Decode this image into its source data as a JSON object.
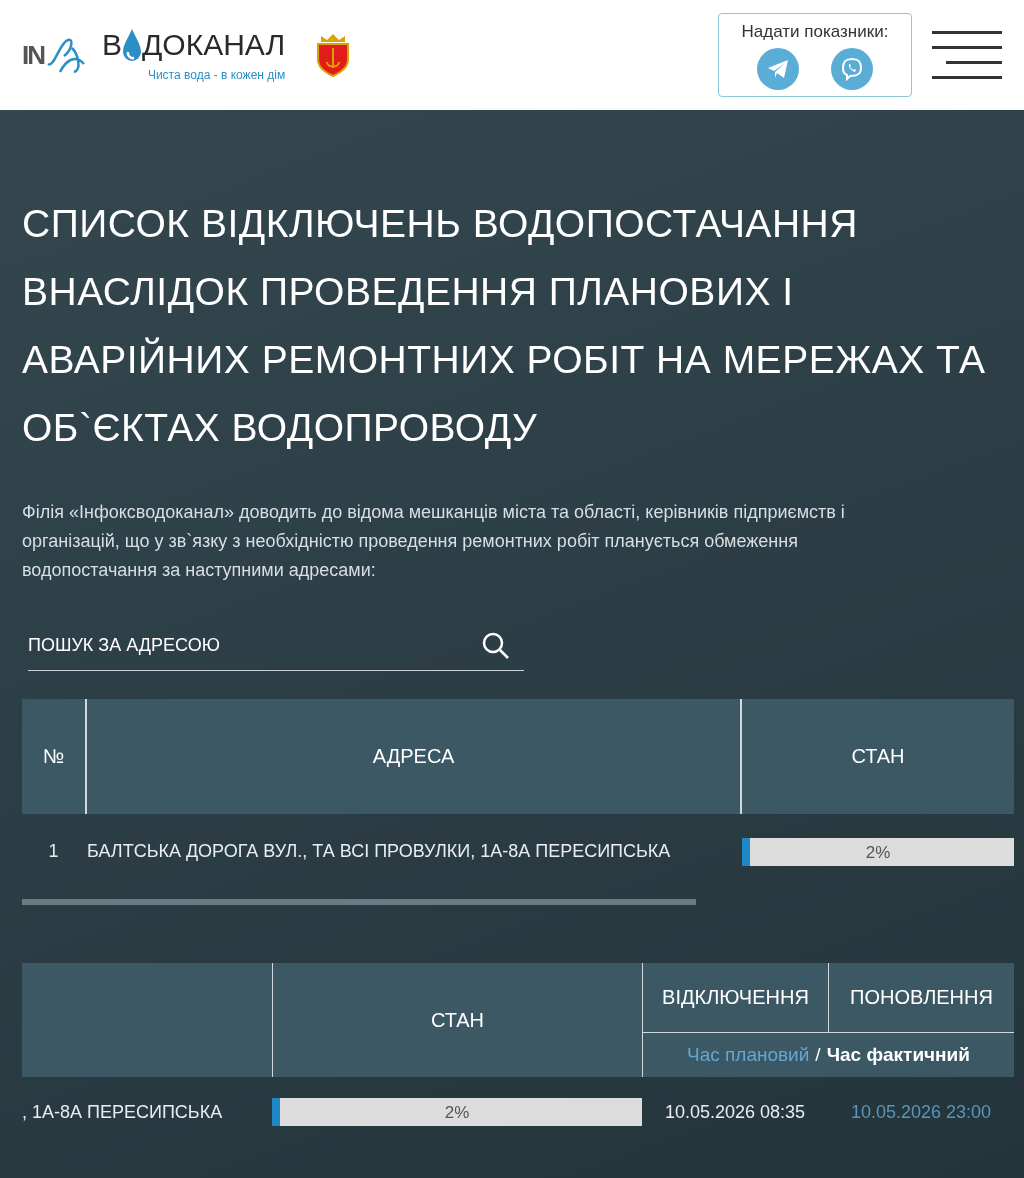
{
  "header": {
    "logo_mark": "IN",
    "brand_first": "В",
    "brand_rest": "ДОКАНАЛ",
    "tagline": "Чиста вода - в кожен дім",
    "submit_box": {
      "label": "Надати показники:"
    }
  },
  "title": "СПИСОК ВІДКЛЮЧЕНЬ ВОДОПОСТАЧАННЯ ВНАСЛІДОК ПРОВЕДЕННЯ ПЛАНОВИХ І АВАРІЙНИХ РЕМОНТНИХ РОБІТ НА МЕРЕЖАХ ТА ОБ`ЄКТАХ ВОДОПРОВОДУ",
  "intro": "Філія «Інфоксводоканал» доводить до відома мешканців міста та області, керівників підприємств і організацій, що у зв`язку з необхідністю проведення ремонтних робіт планується обмеження водопостачання за наступними адресами:",
  "search": {
    "placeholder": "ПОШУК ЗА АДРЕСОЮ"
  },
  "table": {
    "columns": [
      "№",
      "АДРЕСА",
      "СТАН"
    ],
    "rows": [
      {
        "number": "1",
        "address": "БАЛТСЬКА ДОРОГА ВУЛ., ТА ВСІ ПРОВУЛКИ, 1А-8А ПЕРЕСИПСЬКА",
        "level": 0.02,
        "reading": "2%"
      }
    ]
  },
  "table_scrolled": {
    "columns": [
      "СТАН",
      "ВІДКЛЮЧЕННЯ",
      "ПОНОВЛЕННЯ"
    ],
    "time_planned": "Час плановий",
    "separator": "/",
    "time_actual": "Час фактичний",
    "rows": [
      {
        "address": ", 1А-8А ПЕРЕСИПСЬКА",
        "level": 0.02,
        "reading": "2%",
        "off_time": "10.05.2026 08:35",
        "restore_time": "10.05.2026 23:00"
      }
    ]
  }
}
